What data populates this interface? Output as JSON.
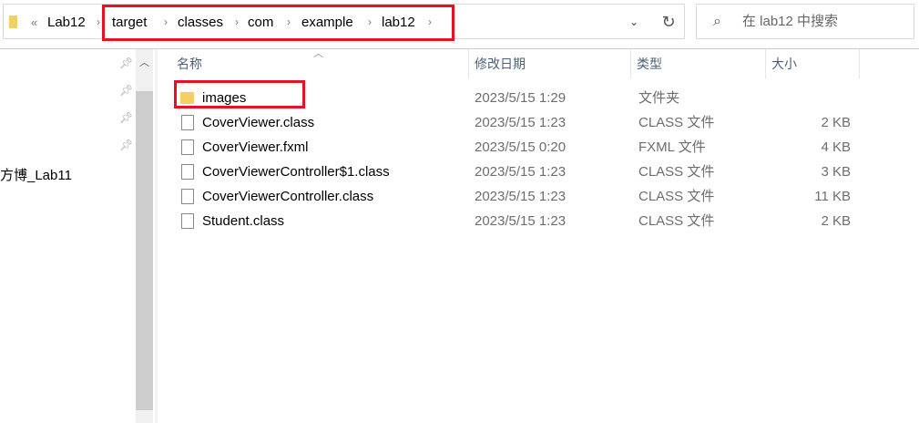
{
  "address": {
    "overflow": "«",
    "crumbs": [
      "Lab12",
      "target",
      "classes",
      "com",
      "example",
      "lab12"
    ]
  },
  "search": {
    "placeholder": "在 lab12 中搜索"
  },
  "nav": {
    "item": "方博_Lab11"
  },
  "columns": {
    "name": "名称",
    "date": "修改日期",
    "type": "类型",
    "size": "大小"
  },
  "files": [
    {
      "name": "images",
      "date": "2023/5/15 1:29",
      "type": "文件夹",
      "size": "",
      "icon": "folder"
    },
    {
      "name": "CoverViewer.class",
      "date": "2023/5/15 1:23",
      "type": "CLASS 文件",
      "size": "2 KB",
      "icon": "file"
    },
    {
      "name": "CoverViewer.fxml",
      "date": "2023/5/15 0:20",
      "type": "FXML 文件",
      "size": "4 KB",
      "icon": "file"
    },
    {
      "name": "CoverViewerController$1.class",
      "date": "2023/5/15 1:23",
      "type": "CLASS 文件",
      "size": "3 KB",
      "icon": "file"
    },
    {
      "name": "CoverViewerController.class",
      "date": "2023/5/15 1:23",
      "type": "CLASS 文件",
      "size": "11 KB",
      "icon": "file"
    },
    {
      "name": "Student.class",
      "date": "2023/5/15 1:23",
      "type": "CLASS 文件",
      "size": "2 KB",
      "icon": "file"
    }
  ],
  "highlight_color": "#e81123"
}
